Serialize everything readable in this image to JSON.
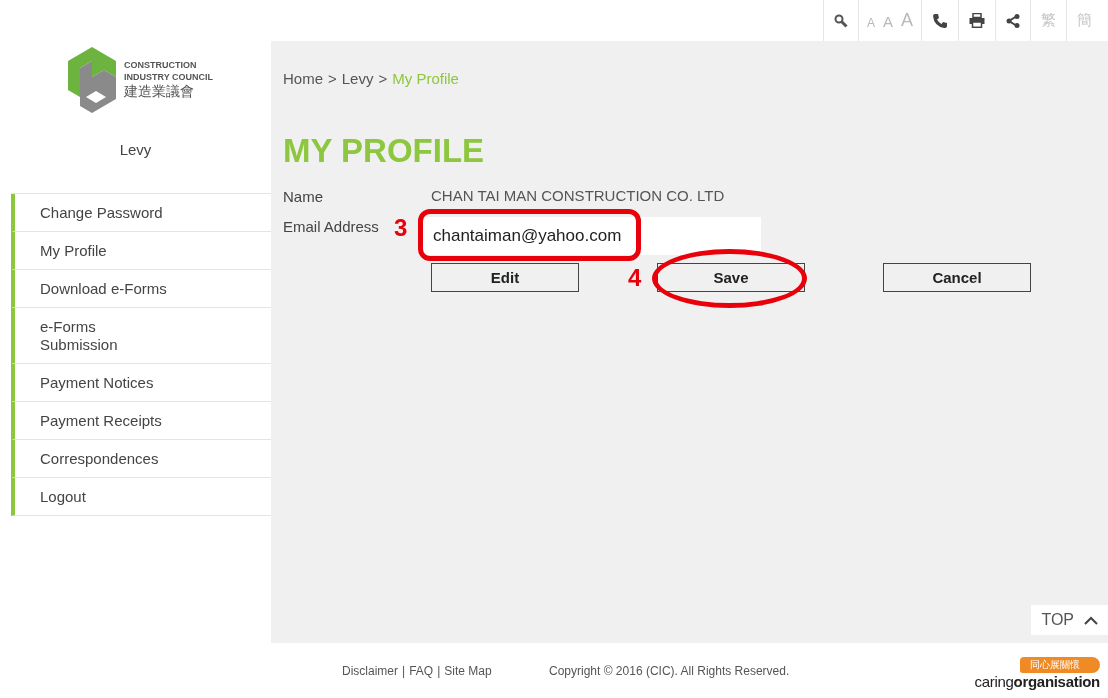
{
  "toolbar": {
    "font_sizes": [
      "A",
      "A",
      "A"
    ],
    "languages": [
      "繁",
      "簡"
    ]
  },
  "logo": {
    "line1": "CONSTRUCTION",
    "line2": "INDUSTRY COUNCIL",
    "chinese": "建造業議會"
  },
  "sidebar": {
    "title": "Levy",
    "items": [
      {
        "label": "Change Password"
      },
      {
        "label": "My Profile"
      },
      {
        "label": "Download e-Forms"
      },
      {
        "label": "e-Forms\nSubmission"
      },
      {
        "label": "Payment Notices"
      },
      {
        "label": "Payment Receipts"
      },
      {
        "label": "Correspondences"
      },
      {
        "label": "Logout"
      }
    ]
  },
  "breadcrumb": [
    {
      "label": "Home",
      "current": false
    },
    {
      "label": "Levy",
      "current": false
    },
    {
      "label": "My Profile",
      "current": true
    }
  ],
  "breadcrumb_separator": ">",
  "page_title": "MY PROFILE",
  "form": {
    "fields": [
      {
        "label": "Name",
        "kind": "text",
        "value": "CHAN TAI MAN CONSTRUCTION CO. LTD"
      },
      {
        "label": "Email Address",
        "kind": "input",
        "value": "chantaiman@yahoo.com"
      }
    ],
    "buttons": [
      "Edit",
      "Save",
      "Cancel"
    ]
  },
  "annotations": [
    {
      "label": "3",
      "kind": "box"
    },
    {
      "label": "4",
      "kind": "ellipse"
    }
  ],
  "top_button": "TOP",
  "footer": {
    "links": [
      "Disclaimer",
      "FAQ",
      "Site Map"
    ],
    "link_separator": "|",
    "copyright": "Copyright © 2016 (CIC). All Rights Reserved."
  },
  "badge": {
    "chinese": "同心展關懷",
    "logo_text": "caring**organisation**"
  }
}
